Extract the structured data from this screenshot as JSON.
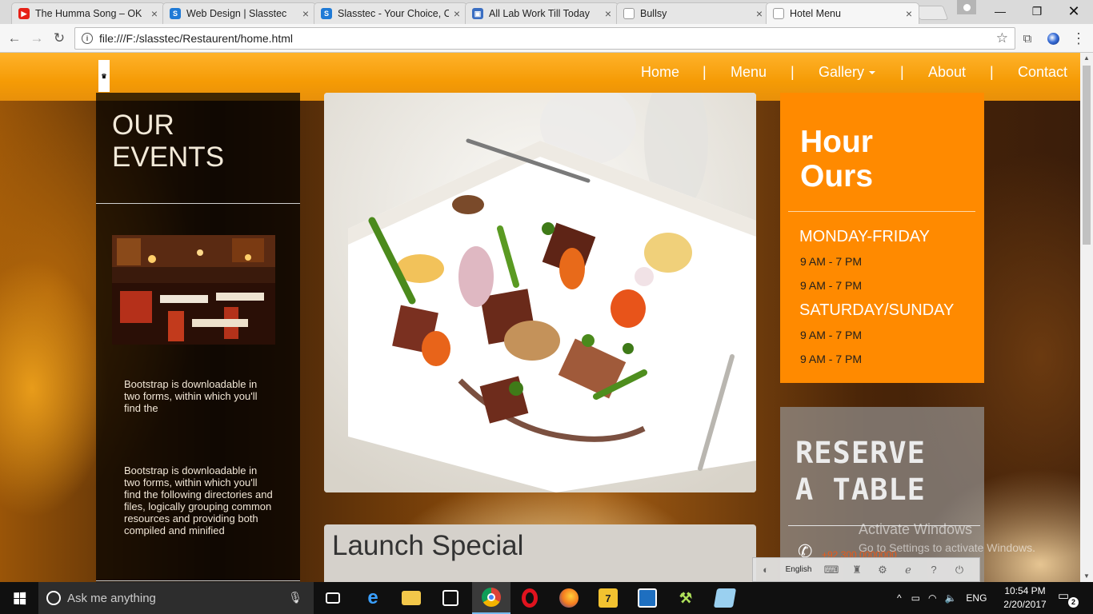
{
  "browser": {
    "tabs": [
      {
        "title": "The Humma Song – OK",
        "icon": "youtube-icon",
        "color": "#e62117"
      },
      {
        "title": "Web Design | Slasstec",
        "icon": "slasstec-icon",
        "color": "#1f7ad6"
      },
      {
        "title": "Slasstec - Your Choice, O",
        "icon": "slasstec-icon",
        "color": "#1f7ad6"
      },
      {
        "title": "All Lab Work Till Today",
        "icon": "contacts-icon",
        "color": "#3a6ec2"
      },
      {
        "title": "Bullsy",
        "icon": "page-icon",
        "color": "#9e9e9e"
      },
      {
        "title": "Hotel Menu",
        "icon": "page-icon",
        "color": "#9e9e9e"
      }
    ],
    "close_glyph": "×",
    "url": "file:///F:/slasstec/Restaurent/home.html"
  },
  "site": {
    "logo_text": "♛",
    "nav": {
      "home": "Home",
      "menu": "Menu",
      "gallery": "Gallery",
      "about": "About",
      "contact": "Contact",
      "separator": "|"
    },
    "events": {
      "title_line1": "OUR",
      "title_line2": "EVENTS",
      "text1": "Bootstrap is downloadable in two forms, within which you'll find the",
      "text2": "Bootstrap is downloadable in two forms, within which you'll find the following directories and files, logically grouping common resources and providing both compiled and minified"
    },
    "carousel": {
      "slide_count": 3,
      "active_slide": 1
    },
    "launch": {
      "title": "Launch Special"
    },
    "hours": {
      "title_line1": "Hour",
      "title_line2": "Ours",
      "weekday_label": "MONDAY-FRIDAY",
      "weekday_time1": "9 AM - 7 PM",
      "weekday_time2": "9 AM - 7 PM",
      "weekend_label": "SATURDAY/SUNDAY",
      "weekend_time1": "9 AM - 7 PM",
      "weekend_time2": "9 AM - 7 PM"
    },
    "reserve": {
      "title_line1": "RESERVE",
      "title_line2": "A TABLE",
      "phone_number": "+92 300 0000000"
    },
    "colors": {
      "nav_orange": "#f59b05",
      "hours_orange": "#ff8a00"
    }
  },
  "watermark": {
    "line1": "Activate Windows",
    "line2": "Go to Settings to activate Windows."
  },
  "language_bar": {
    "language": "English"
  },
  "taskbar": {
    "search_placeholder": "Ask me anything",
    "language": "ENG",
    "time": "10:54 PM",
    "date": "2/20/2017",
    "notification_count": "2"
  }
}
